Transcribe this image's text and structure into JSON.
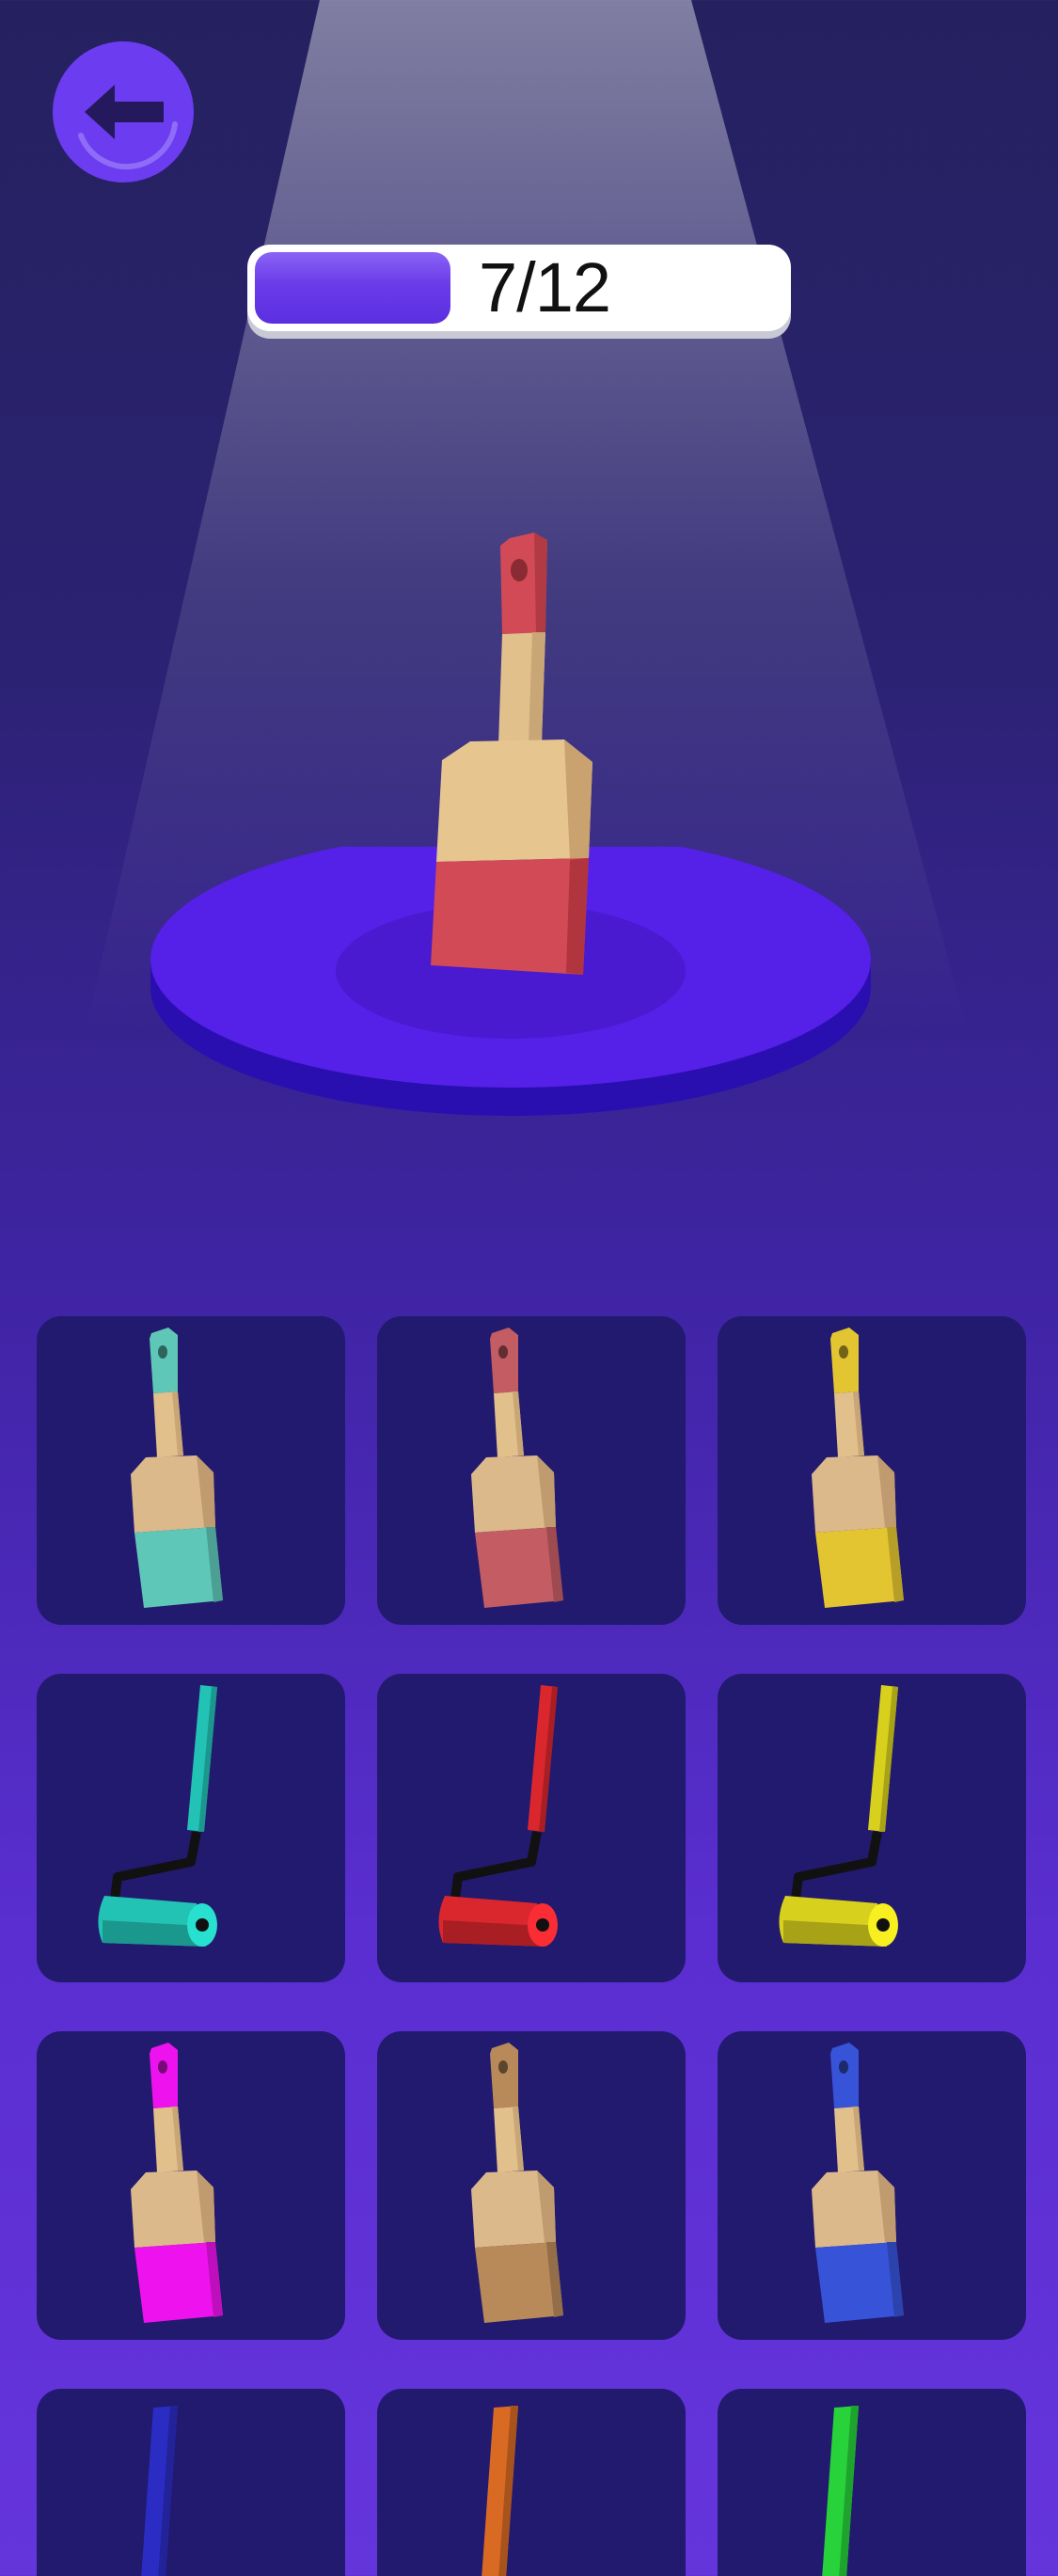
{
  "header": {
    "back_icon": "arrow-left-icon"
  },
  "progress": {
    "text": "7/12",
    "value": 7,
    "total": 12,
    "fill_fraction": 0.37
  },
  "colors": {
    "accent": "#6b3cf0",
    "pedestal": "#5520e8",
    "slot_bg": "#221a6e"
  },
  "showcase": {
    "item": "paint-brush",
    "color": "#d24a55"
  },
  "inventory": [
    {
      "type": "brush",
      "color": "#5ec7b8",
      "name": "teal-brush"
    },
    {
      "type": "brush",
      "color": "#c45c64",
      "name": "rose-brush"
    },
    {
      "type": "brush",
      "color": "#e3c531",
      "name": "yellow-brush"
    },
    {
      "type": "roller",
      "color": "#22c3b5",
      "name": "teal-roller"
    },
    {
      "type": "roller",
      "color": "#d9272d",
      "name": "red-roller"
    },
    {
      "type": "roller",
      "color": "#d7d01c",
      "name": "yellow-roller"
    },
    {
      "type": "brush",
      "color": "#ee13ee",
      "name": "magenta-brush"
    },
    {
      "type": "brush",
      "color": "#b88a5a",
      "name": "tan-brush"
    },
    {
      "type": "brush",
      "color": "#3753d8",
      "name": "blue-brush"
    },
    {
      "type": "stick",
      "color": "#2b2cc4",
      "name": "indigo-item"
    },
    {
      "type": "stick",
      "color": "#d96a24",
      "name": "orange-item"
    },
    {
      "type": "stick",
      "color": "#27d23a",
      "name": "green-item"
    }
  ]
}
